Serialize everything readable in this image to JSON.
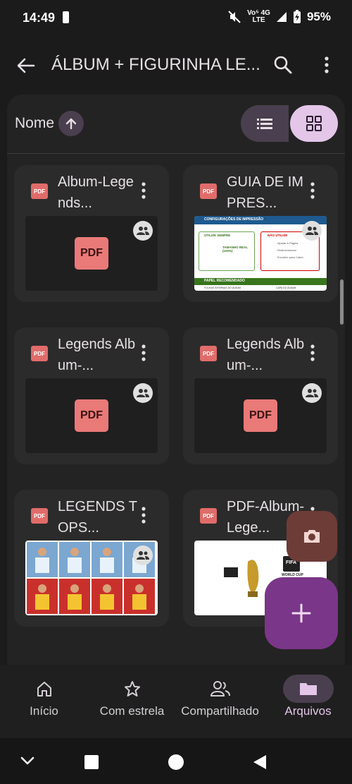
{
  "status_bar": {
    "time": "14:49",
    "network_top": "Vo⁵ 4G",
    "network_bottom": "LTE",
    "battery": "95%"
  },
  "app_bar": {
    "title": "ÁLBUM + FIGURINHA LE..."
  },
  "sort": {
    "label": "Nome"
  },
  "files": [
    {
      "name": "Album-Legends...",
      "type_icon": "PDF",
      "thumbnail": "PDF",
      "shared": true
    },
    {
      "name": "GUIA DE IMPRES...",
      "type_icon": "PDF",
      "thumbnail": "preview-guide",
      "shared": true
    },
    {
      "name": "Legends Album-...",
      "type_icon": "PDF",
      "thumbnail": "PDF",
      "shared": true
    },
    {
      "name": "Legends Album-...",
      "type_icon": "PDF",
      "thumbnail": "PDF",
      "shared": true
    },
    {
      "name": "LEGENDS TOPS...",
      "type_icon": "PDF",
      "thumbnail": "preview-cards",
      "shared": true
    },
    {
      "name": "PDF-Album-Lege...",
      "type_icon": "PDF",
      "thumbnail": "preview-worldcup",
      "shared": false
    }
  ],
  "guide_preview": {
    "section1": "CONFIGURAÇÕES DE IMPRESSÃO",
    "utilize": "UTILIZE SEMPRE",
    "nao_utilize": "NÃO UTILIZE",
    "tamanho": "TAMANHO REAL (100%)",
    "opt1": "Ajustar à Página",
    "opt2": "Redimensionar",
    "opt3": "Encolher para Caber",
    "section2": "PAPEL RECOMENDADO",
    "col1": "FOLHAS INTERNAS DO ÁLBUM",
    "col2": "CAPA DO ÁLBUM"
  },
  "worldcup_preview": {
    "fifa": "FIFA",
    "worldcup": "WORLD CUP"
  },
  "bottom_nav": [
    {
      "label": "Início",
      "icon": "home-icon",
      "active": false
    },
    {
      "label": "Com estrela",
      "icon": "star-icon",
      "active": false
    },
    {
      "label": "Compartilhado",
      "icon": "shared-icon",
      "active": false
    },
    {
      "label": "Arquivos",
      "icon": "folder-icon",
      "active": true
    }
  ],
  "colors": {
    "pdf_red": "#e97a78",
    "accent_purple": "#7a3688",
    "active_pill": "#4a3f4e",
    "grid_toggle": "#e3c6e8"
  }
}
